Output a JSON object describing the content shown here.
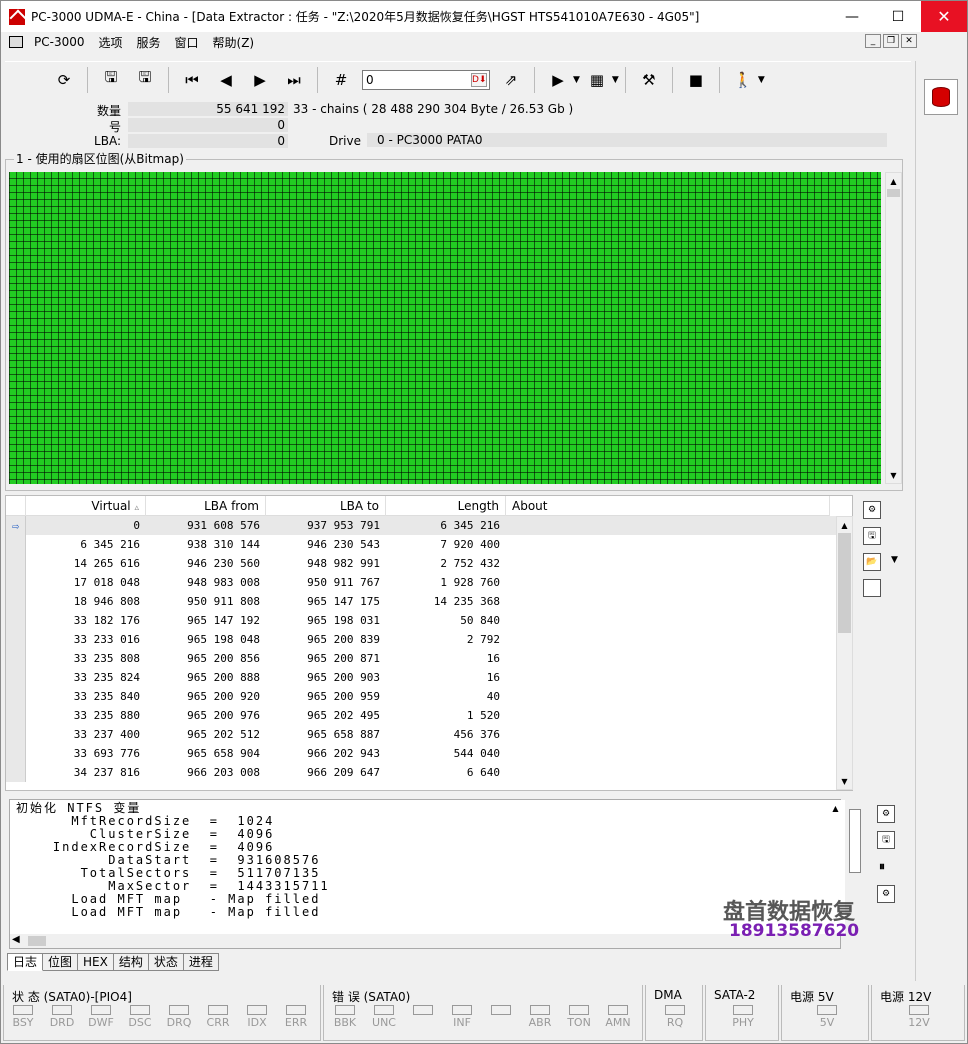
{
  "window": {
    "title": "PC-3000 UDMA-E - China - [Data Extractor : 任务 - \"Z:\\2020年5月数据恢复任务\\HGST HTS541010A7E630 - 4G05\"]",
    "minimize": "—",
    "maximize": "☐",
    "close": "✕"
  },
  "menu": [
    "PC-3000",
    "选项",
    "服务",
    "窗口",
    "帮助(Z)"
  ],
  "toolbar": {
    "input_value": "0"
  },
  "info": {
    "count_label": "数量",
    "count_value": "55 641 192",
    "count_desc": "33 - chains  ( 28 488 290 304 Byte  /  26.53 Gb )",
    "num_label": "号",
    "num_value": "0",
    "lba_label": "LBA:",
    "lba_value": "0",
    "drive_label": "Drive",
    "drive_value": "0 - PC3000 PATA0"
  },
  "bitmap": {
    "label": "1 - 使用的扇区位图(从Bitmap)",
    "used_color": "#22cc22",
    "used_fraction": 1.0
  },
  "table": {
    "headers": [
      "Virtual",
      "LBA from",
      "LBA to",
      "Length",
      "About"
    ],
    "sort_indicator": "▵",
    "rows": [
      [
        "0",
        "931 608 576",
        "937 953 791",
        "6 345 216",
        ""
      ],
      [
        "6 345 216",
        "938 310 144",
        "946 230 543",
        "7 920 400",
        ""
      ],
      [
        "14 265 616",
        "946 230 560",
        "948 982 991",
        "2 752 432",
        ""
      ],
      [
        "17 018 048",
        "948 983 008",
        "950 911 767",
        "1 928 760",
        ""
      ],
      [
        "18 946 808",
        "950 911 808",
        "965 147 175",
        "14 235 368",
        ""
      ],
      [
        "33 182 176",
        "965 147 192",
        "965 198 031",
        "50 840",
        ""
      ],
      [
        "33 233 016",
        "965 198 048",
        "965 200 839",
        "2 792",
        ""
      ],
      [
        "33 235 808",
        "965 200 856",
        "965 200 871",
        "16",
        ""
      ],
      [
        "33 235 824",
        "965 200 888",
        "965 200 903",
        "16",
        ""
      ],
      [
        "33 235 840",
        "965 200 920",
        "965 200 959",
        "40",
        ""
      ],
      [
        "33 235 880",
        "965 200 976",
        "965 202 495",
        "1 520",
        ""
      ],
      [
        "33 237 400",
        "965 202 512",
        "965 658 887",
        "456 376",
        ""
      ],
      [
        "33 693 776",
        "965 658 904",
        "966 202 943",
        "544 040",
        ""
      ],
      [
        "34 237 816",
        "966 203 008",
        "966 209 647",
        "6 640",
        ""
      ]
    ]
  },
  "log": {
    "lines": [
      "初始化 NTFS 变量",
      "      MftRecordSize  =  1024",
      "        ClusterSize  =  4096",
      "    IndexRecordSize  =  4096",
      "          DataStart  =  931608576",
      "       TotalSectors  =  511707135",
      "          MaxSector  =  1443315711",
      "      Load MFT map   - Map filled",
      "      Load MFT map   - Map filled"
    ]
  },
  "watermark": {
    "line1": "盘首数据恢复",
    "line2": "18913587620",
    "line2_color": "#7a1fb2"
  },
  "tabs": [
    "日志",
    "位图",
    "HEX",
    "结构",
    "状态",
    "进程"
  ],
  "status": {
    "state_title": "状 态 (SATA0)-[PIO4]",
    "state_leds": [
      "BSY",
      "DRD",
      "DWF",
      "DSC",
      "DRQ",
      "CRR",
      "IDX",
      "ERR"
    ],
    "error_title": "错 误 (SATA0)",
    "error_leds": [
      "BBK",
      "UNC",
      "",
      "INF",
      "",
      "ABR",
      "TON",
      "AMN"
    ],
    "dma_title": "DMA",
    "dma_leds": [
      "RQ"
    ],
    "sata_title": "SATA-2",
    "sata_leds": [
      "PHY"
    ],
    "p5_title": "电源 5V",
    "p5_leds": [
      "5V"
    ],
    "p12_title": "电源 12V",
    "p12_leds": [
      "12V"
    ]
  }
}
